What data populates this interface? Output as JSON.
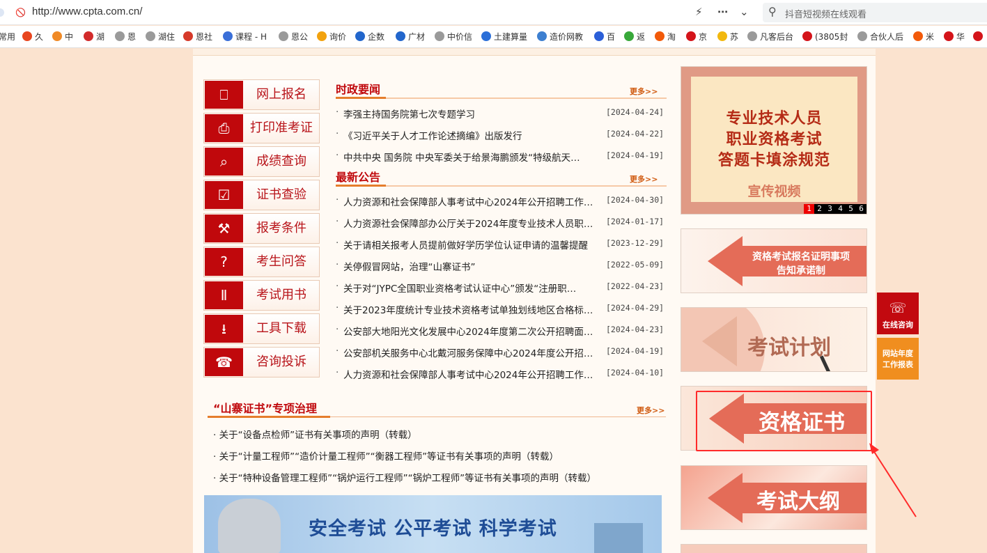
{
  "browser": {
    "url": "http://www.cpta.com.cn/",
    "search_placeholder": "抖音短视频在线观看",
    "bookmarks": [
      {
        "label": "常用",
        "color": "#ffffff"
      },
      {
        "label": "久",
        "color": "#e8451e"
      },
      {
        "label": "中",
        "color": "#f08a26"
      },
      {
        "label": "湖",
        "color": "#d22b2b"
      },
      {
        "label": "恩",
        "color": "#9a9a9a"
      },
      {
        "label": "湖住",
        "color": "#9a9a9a"
      },
      {
        "label": "恩社",
        "color": "#d63a2a"
      },
      {
        "label": "课程 - H",
        "color": "#3a6fd8"
      },
      {
        "label": "恩公",
        "color": "#9a9a9a"
      },
      {
        "label": "询价",
        "color": "#f2a20e"
      },
      {
        "label": "企数",
        "color": "#2266cc"
      },
      {
        "label": "广材",
        "color": "#2266cc"
      },
      {
        "label": "中价信",
        "color": "#9a9a9a"
      },
      {
        "label": "土建算量",
        "color": "#2b6fd8"
      },
      {
        "label": "造价网教",
        "color": "#3d7fd0"
      },
      {
        "label": "百",
        "color": "#2b5fd8"
      },
      {
        "label": "返",
        "color": "#38a83a"
      },
      {
        "label": "淘",
        "color": "#f25a0a"
      },
      {
        "label": "京",
        "color": "#d4141a"
      },
      {
        "label": "苏",
        "color": "#f2b80e"
      },
      {
        "label": "凡客后台",
        "color": "#9a9a9a"
      },
      {
        "label": "(3805封",
        "color": "#d4141a"
      },
      {
        "label": "合伙人后",
        "color": "#9a9a9a"
      },
      {
        "label": "米",
        "color": "#f25a0a"
      },
      {
        "label": "华",
        "color": "#d4141a"
      },
      {
        "label": "",
        "color": "#d4141a"
      }
    ]
  },
  "nav": [
    {
      "label": "网上报名",
      "icon": "computer-icon"
    },
    {
      "label": "打印准考证",
      "icon": "printer-icon"
    },
    {
      "label": "成绩查询",
      "icon": "document-search-icon"
    },
    {
      "label": "证书查验",
      "icon": "certificate-check-icon"
    },
    {
      "label": "报考条件",
      "icon": "tools-icon"
    },
    {
      "label": "考生问答",
      "icon": "question-icon"
    },
    {
      "label": "考试用书",
      "icon": "books-icon"
    },
    {
      "label": "工具下载",
      "icon": "download-icon"
    },
    {
      "label": "咨询投诉",
      "icon": "phone-icon"
    }
  ],
  "news": {
    "title": "时政要闻",
    "more": "更多>>",
    "items": [
      {
        "title": "李强主持国务院第七次专题学习",
        "date": "[2024-04-24]"
      },
      {
        "title": "《习近平关于人才工作论述摘编》出版发行",
        "date": "[2024-04-22]"
      },
      {
        "title": "中共中央 国务院 中央军委关于给景海鹏颁发“特级航天…",
        "date": "[2024-04-19]"
      }
    ]
  },
  "notices": {
    "title": "最新公告",
    "more": "更多>>",
    "items": [
      {
        "title": "人力资源和社会保障部人事考试中心2024年公开招聘工作…",
        "date": "[2024-04-30]"
      },
      {
        "title": "人力资源社会保障部办公厅关于2024年度专业技术人员职…",
        "date": "[2024-01-17]"
      },
      {
        "title": "关于请相关报考人员提前做好学历学位认证申请的温馨提醒",
        "date": "[2023-12-29]"
      },
      {
        "title": "关停假冒网站，治理“山寨证书”",
        "date": "[2022-05-09]"
      },
      {
        "title": "关于对“JYPC全国职业资格考试认证中心”颁发“注册职…",
        "date": "[2022-04-23]"
      },
      {
        "title": "关于2023年度统计专业技术资格考试单独划线地区合格标…",
        "date": "[2024-04-29]"
      },
      {
        "title": "公安部大地阳光文化发展中心2024年度第二次公开招聘面…",
        "date": "[2024-04-23]"
      },
      {
        "title": "公安部机关服务中心北戴河服务保障中心2024年度公开招…",
        "date": "[2024-04-19]"
      },
      {
        "title": "人力资源和社会保障部人事考试中心2024年公开招聘工作…",
        "date": "[2024-04-10]"
      }
    ]
  },
  "fake_cert": {
    "title": "“山寨证书”专项治理",
    "more": "更多>>",
    "items": [
      {
        "title": "关于“设备点检师”证书有关事项的声明（转载）"
      },
      {
        "title": "关于“计量工程师”“造价计量工程师”“衡器工程师”等证书有关事项的声明（转载）"
      },
      {
        "title": "关于“特种设备管理工程师”“锅炉运行工程师”“锅炉工程师”等证书有关事项的声明（转载）"
      }
    ]
  },
  "banner": {
    "text": "安全考试  公平考试  科学考试"
  },
  "promo": {
    "lines": [
      "专业技术人员",
      "职业资格考试",
      "答题卡填涂规范"
    ],
    "video": "宣传视频",
    "pages": [
      "1",
      "2",
      "3",
      "4",
      "5",
      "6"
    ],
    "active_page": "1"
  },
  "side_links": [
    {
      "label": "资格考试报名证明事项告知承诺制",
      "line1": "资格考试报名证明事项",
      "line2": "告知承诺制"
    },
    {
      "label": "考试计划"
    },
    {
      "label": "资格证书"
    },
    {
      "label": "考试大纲"
    }
  ],
  "float": {
    "consult": "在线咨询",
    "report_l1": "网站年度",
    "report_l2": "工作报表"
  },
  "colors": {
    "brand_red": "#c0080c",
    "accent_orange": "#e57d2c",
    "annotation_red": "#ff2a2a"
  }
}
